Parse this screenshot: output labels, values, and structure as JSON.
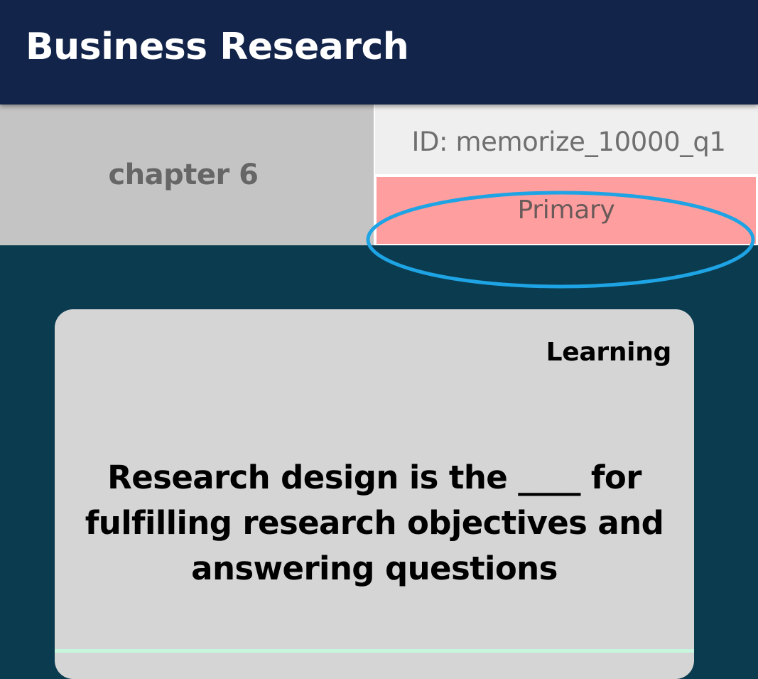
{
  "app_bar": {
    "title": "Business Research"
  },
  "info": {
    "chapter": "chapter 6",
    "id": "ID: memorize_10000_q1",
    "type": "Primary"
  },
  "card": {
    "mode": "Learning",
    "question": "Research design is the ____ for fulfilling research objectives and answering questions"
  },
  "colors": {
    "app_bar_bg": "#13244a",
    "page_bg": "#0a3b4f",
    "chapter_bg": "#c4c4c4",
    "id_bg": "#efefef",
    "type_bg": "#ff9e9e",
    "card_bg": "#d5d5d5",
    "highlight": "#1ea4e4"
  }
}
